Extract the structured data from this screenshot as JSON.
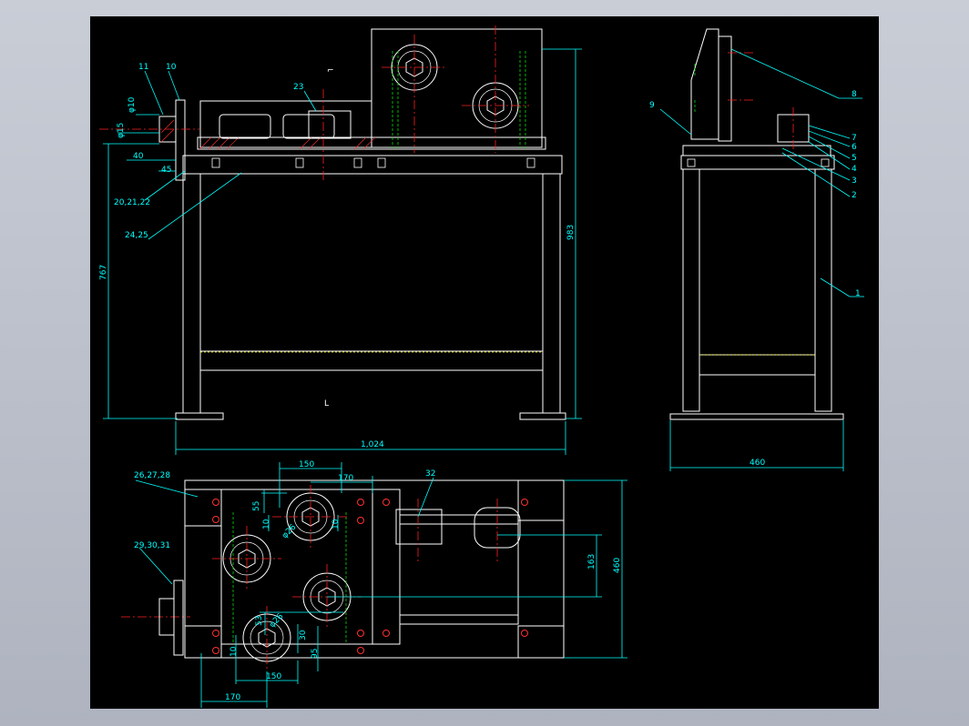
{
  "drawing": {
    "front_view": {
      "part_labels": [
        "11",
        "10",
        "23",
        "20,21,22",
        "24,25"
      ],
      "dimensions": [
        "φ10",
        "φ15",
        "40",
        "45",
        "767",
        "983",
        "1,024"
      ]
    },
    "side_view": {
      "part_labels": [
        "8",
        "9",
        "7",
        "6",
        "5",
        "4",
        "3",
        "2",
        "1"
      ],
      "dimensions": [
        "460"
      ]
    },
    "top_view": {
      "part_labels": [
        "26,27,28",
        "29,30,31",
        "32"
      ],
      "dimensions": [
        "150",
        "170",
        "55",
        "10",
        "φ26",
        "10",
        "163",
        "460",
        "53",
        "φ26",
        "30",
        "10",
        "95",
        "150",
        "170"
      ]
    }
  }
}
